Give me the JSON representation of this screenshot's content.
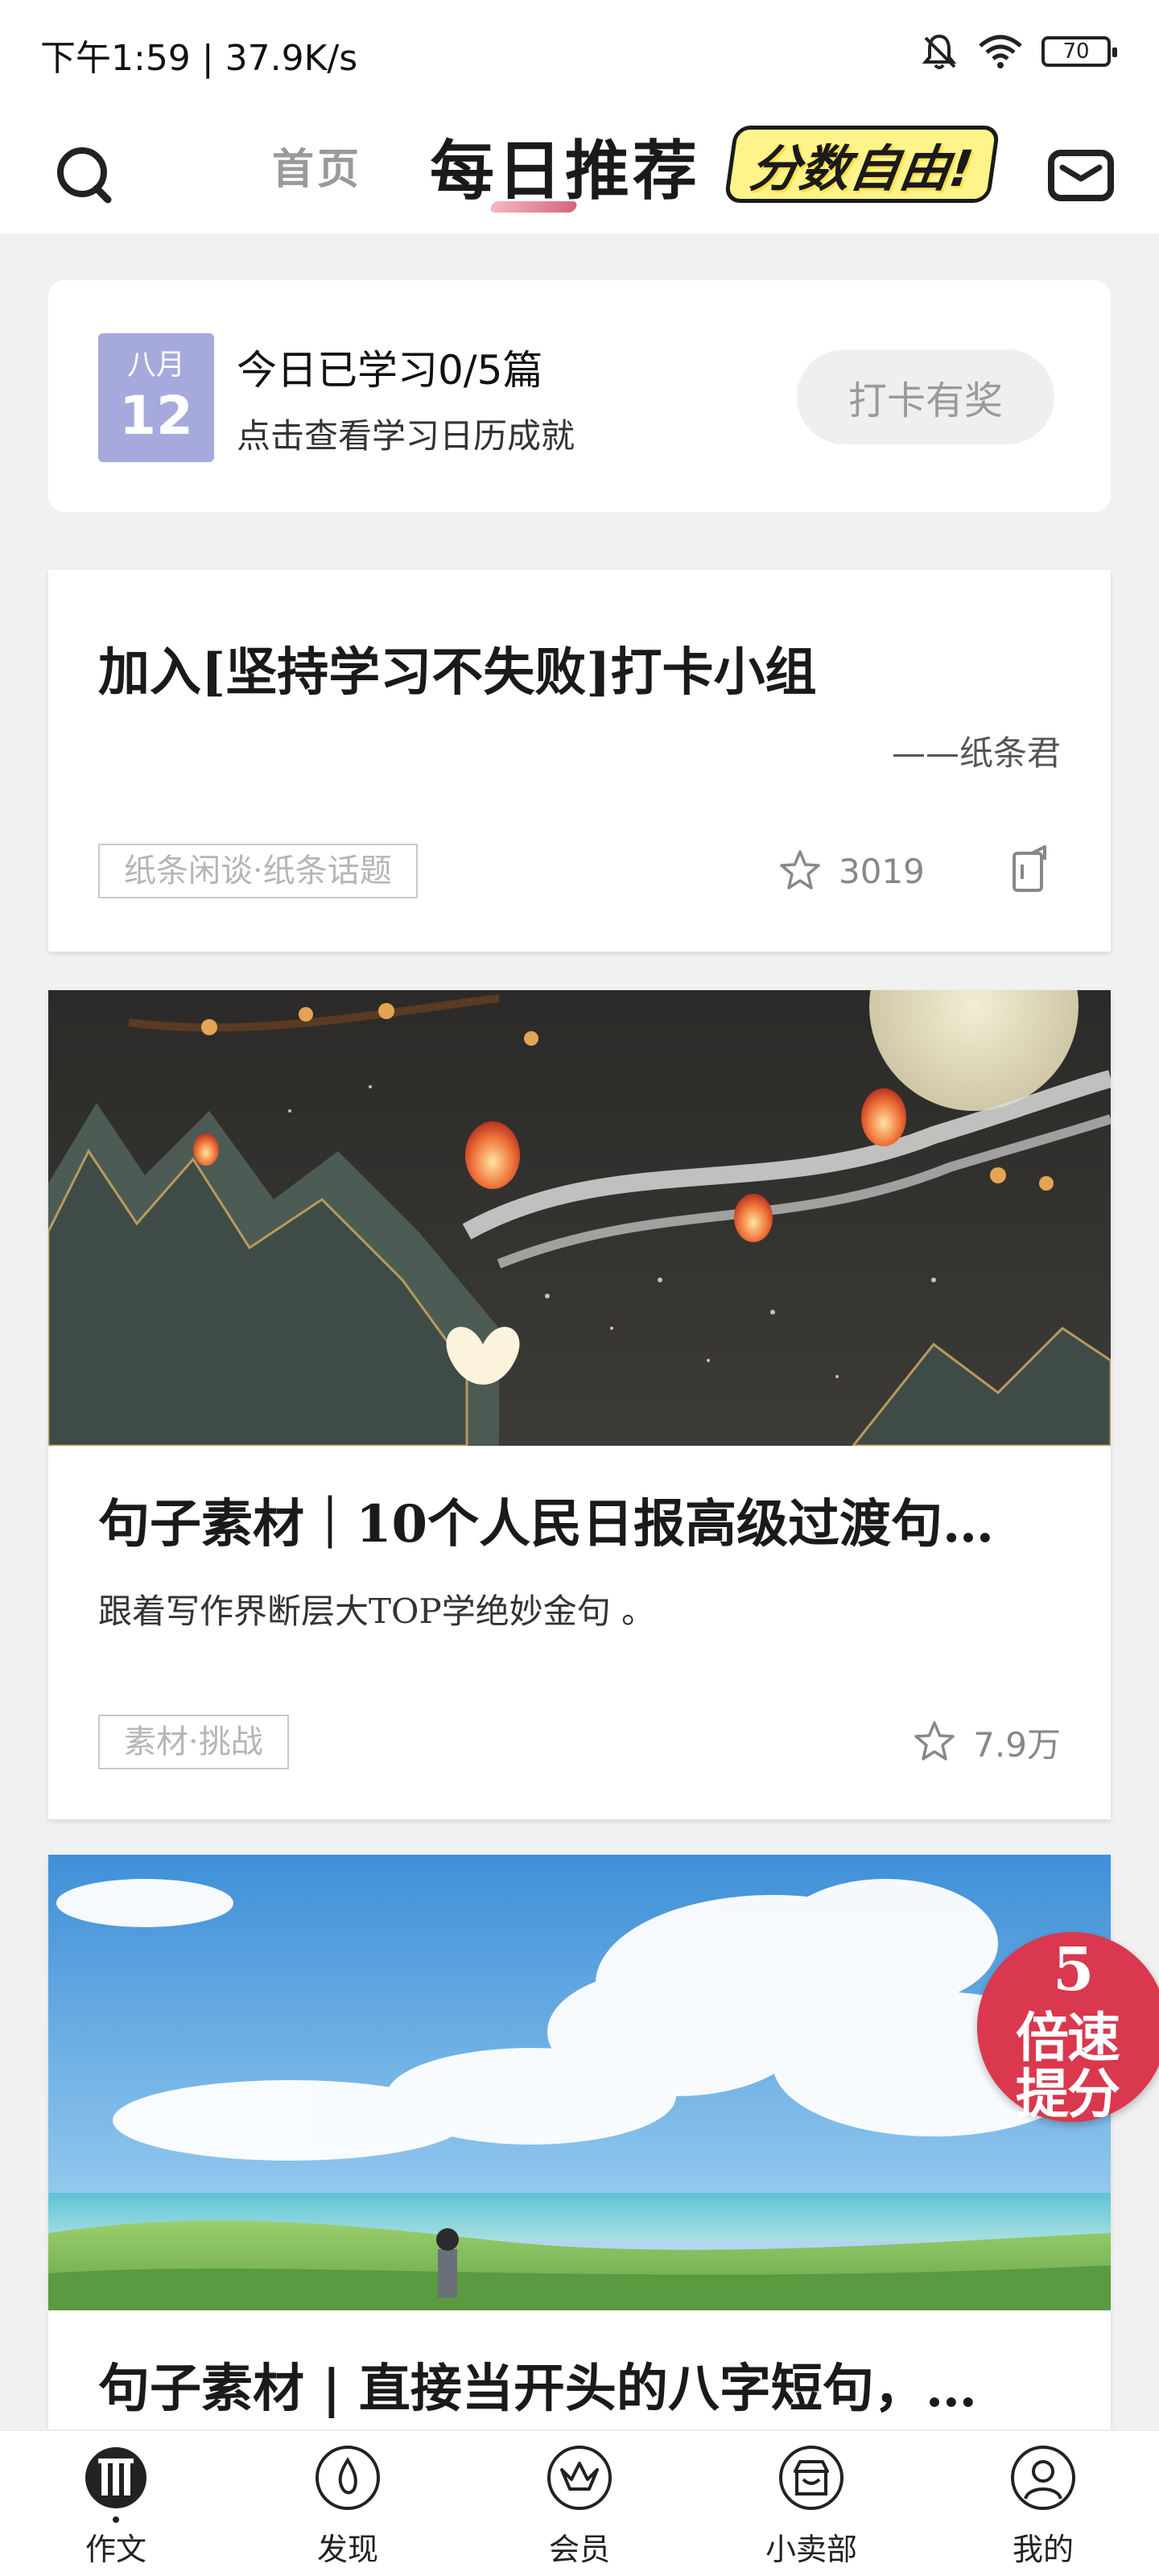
{
  "status_bar": {
    "time": "下午1:59 | 37.9K/s",
    "battery": "70"
  },
  "header": {
    "tabs": [
      {
        "label": "首页",
        "active": false
      },
      {
        "label": "每日推荐",
        "active": true
      }
    ],
    "promo_badge": "分数自由!",
    "icons": [
      "search-icon",
      "mail-icon"
    ]
  },
  "checkin": {
    "month": "八月",
    "day": "12",
    "title": "今日已学习0/5篇",
    "subtitle": "点击查看学习日历成就",
    "button": "打卡有奖"
  },
  "cards": [
    {
      "title": "加入[坚持学习不失败]打卡小组",
      "author": "——纸条君",
      "tag": "纸条闲谈·纸条话题",
      "stars": "3019"
    },
    {
      "title": "句子素材｜10个人民日报高级过渡句…",
      "description": "跟着写作界断层大TOP学绝妙金句 。",
      "tag": "素材·挑战",
      "stars": "7.9万"
    },
    {
      "title": "句子素材 | 直接当开头的八字短句，…"
    }
  ],
  "speed_badge": {
    "number": "5",
    "line1": "倍速",
    "line2": "提分"
  },
  "bottom_nav": [
    {
      "label": "作文",
      "icon": "essay-icon",
      "active": true
    },
    {
      "label": "发现",
      "icon": "discover-icon",
      "active": false
    },
    {
      "label": "会员",
      "icon": "member-crown-icon",
      "active": false
    },
    {
      "label": "小卖部",
      "icon": "shop-icon",
      "active": false
    },
    {
      "label": "我的",
      "icon": "profile-icon",
      "active": false
    }
  ],
  "colors": {
    "calendar_badge": "#a5a9dc",
    "accent_pink": "#d6657a",
    "speed_badge": "#d9384e",
    "background": "#f1f1f1"
  }
}
